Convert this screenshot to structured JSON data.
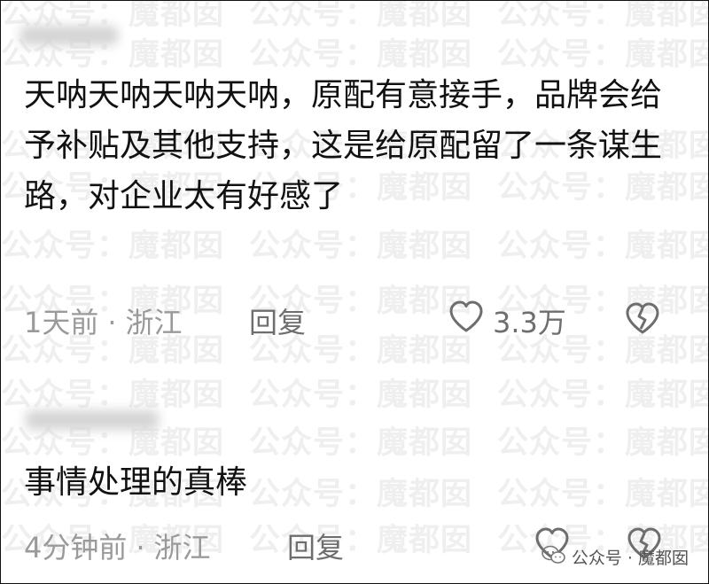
{
  "watermark_text": "公众号：魔都囡",
  "comments": [
    {
      "text": "天呐天呐天呐天呐，原配有意接手，品牌会给予补贴及其他支持，这是给原配留了一条谋生路，对企业太有好感了",
      "time": "1天前",
      "location": "浙江",
      "reply_label": "回复",
      "like_count": "3.3万"
    },
    {
      "text": "事情处理的真棒",
      "time": "4分钟前",
      "location": "浙江",
      "reply_label": "回复",
      "like_count": ""
    }
  ],
  "separator": "·",
  "source": {
    "label": "公众号 · 魔都囡"
  },
  "icons": {
    "like": "heart-outline-icon",
    "dislike": "broken-heart-icon",
    "wechat": "wechat-icon"
  },
  "colors": {
    "text": "#111111",
    "meta": "#9a9a9a",
    "icon": "#6e6e6e",
    "watermark": "#efefef"
  }
}
